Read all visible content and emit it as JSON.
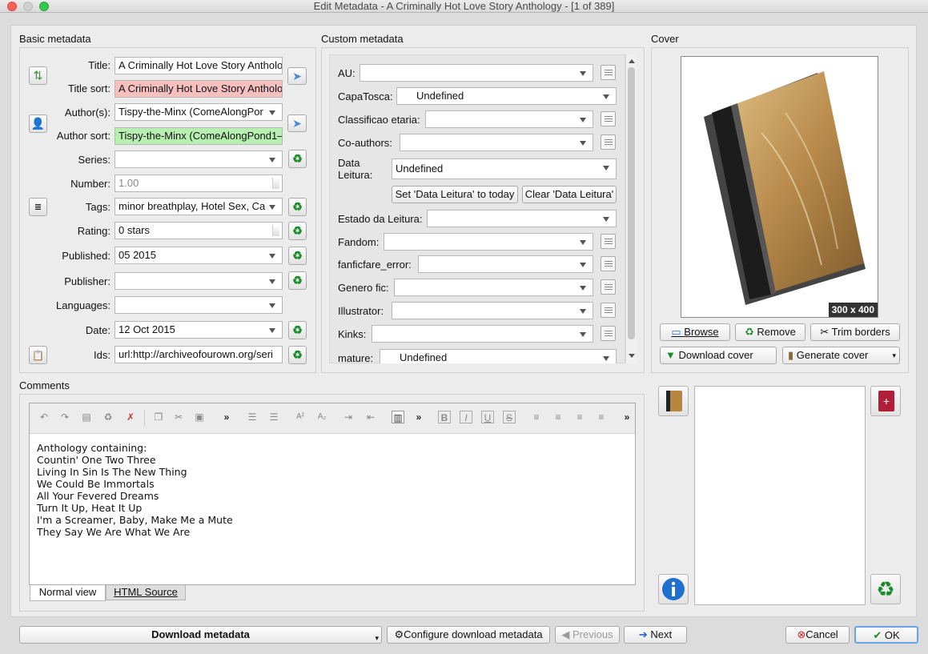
{
  "window": {
    "title": "Edit Metadata - A Criminally Hot Love Story Anthology -  [1 of 389]"
  },
  "basic": {
    "header": "Basic metadata",
    "title_label": "Title:",
    "title_value": "A Criminally Hot Love Story Antholo",
    "title_sort_label": "Title sort:",
    "title_sort_value": "A Criminally Hot Love Story Antholo",
    "authors_label": "Author(s):",
    "authors_value": "Tispy-the-Minx (ComeAlongPor",
    "author_sort_label": "Author sort:",
    "author_sort_value": "Tispy-the-Minx (ComeAlongPond1–",
    "series_label": "Series:",
    "series_value": "",
    "number_label": "Number:",
    "number_value": "1.00",
    "tags_label": "Tags:",
    "tags_value": "minor breathplay, Hotel Sex, Ca",
    "rating_label": "Rating:",
    "rating_value": "0 stars",
    "published_label": "Published:",
    "published_value": "05 2015",
    "publisher_label": "Publisher:",
    "publisher_value": "",
    "languages_label": "Languages:",
    "languages_value": "",
    "date_label": "Date:",
    "date_value": "12 Oct 2015",
    "ids_label": "Ids:",
    "ids_value": "url:http://archiveofourown.org/seri"
  },
  "custom": {
    "header": "Custom metadata",
    "au_label": "AU:",
    "au_value": "",
    "capatosca_label": "CapaTosca:",
    "capatosca_value": "Undefined",
    "classif_label": "Classificao etaria:",
    "classif_value": "",
    "coauthors_label": "Co-authors:",
    "coauthors_value": "",
    "data_leitura_label1": "Data",
    "data_leitura_label2": "Leitura:",
    "data_leitura_value": "Undefined",
    "set_today": "Set 'Data Leitura' to today",
    "clear_data": "Clear 'Data Leitura'",
    "estado_label": "Estado da Leitura:",
    "estado_value": "",
    "fandom_label": "Fandom:",
    "fandom_value": "",
    "fanficfare_label": "fanficfare_error:",
    "fanficfare_value": "",
    "genero_label": "Genero fic:",
    "genero_value": "",
    "illustrator_label": "Illustrator:",
    "illustrator_value": "",
    "kinks_label": "Kinks:",
    "kinks_value": "",
    "mature_label": "mature:",
    "mature_value": "Undefined"
  },
  "cover": {
    "header": "Cover",
    "size_badge": "300 x 400",
    "browse": "Browse",
    "remove": "Remove",
    "trim": "Trim borders",
    "download_cover": "Download cover",
    "generate_cover": "Generate cover"
  },
  "comments": {
    "header": "Comments",
    "lines": [
      "Anthology containing:",
      "Countin' One Two Three",
      "Living In Sin Is The New Thing",
      "We Could Be Immortals",
      "All Your Fevered Dreams",
      "Turn It Up, Heat It Up",
      "I'm a Screamer, Baby, Make Me a Mute",
      "They Say We Are What We Are"
    ],
    "tab_normal": "Normal view",
    "tab_html": "HTML Source"
  },
  "bottom": {
    "download_metadata": "Download metadata",
    "configure": "Configure download metadata",
    "previous": "Previous",
    "next": "Next",
    "cancel": "Cancel",
    "ok": "OK"
  },
  "colors": {
    "pink": "#f7c0c0",
    "green": "#b6efb0",
    "ok_border": "#6aa4e8",
    "recycle": "#1a8a2a"
  }
}
